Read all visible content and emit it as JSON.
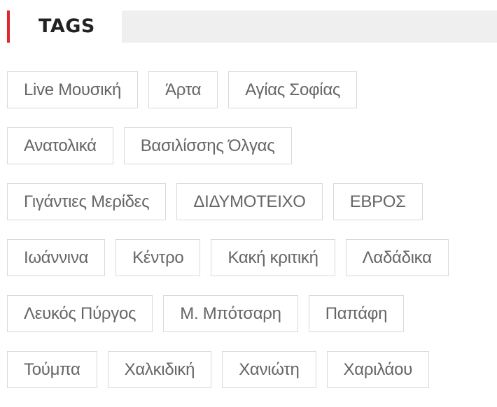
{
  "widget": {
    "title": "TAGS",
    "accent_color": "#e0262c"
  },
  "tags": [
    [
      "Live Μουσική",
      "Άρτα",
      "Αγίας Σοφίας"
    ],
    [
      "Ανατολικά",
      "Βασιλίσσης Όλγας"
    ],
    [
      "Γιγάντιες Μερίδες",
      "ΔΙΔΥΜΟΤΕΙΧΟ",
      "ΕΒΡΟΣ"
    ],
    [
      "Ιωάννινα",
      "Κέντρο",
      "Κακή κριτική",
      "Λαδάδικα"
    ],
    [
      "Λευκός Πύργος",
      "Μ. Μπότσαρη",
      "Παπάφη"
    ],
    [
      "Τούμπα",
      "Χαλκιδική",
      "Χανιώτη",
      "Χαριλάου"
    ]
  ]
}
